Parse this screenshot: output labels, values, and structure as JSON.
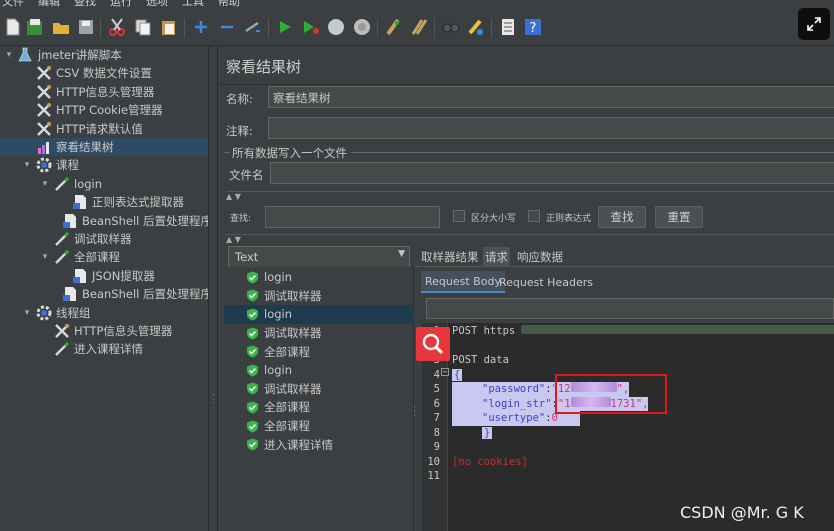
{
  "menubar": {
    "items": [
      "文件",
      "编辑",
      "查找",
      "运行",
      "选项",
      "工具",
      "帮助"
    ]
  },
  "toolbar": {
    "icons": [
      "new-icon",
      "templates-icon",
      "open-icon",
      "save-icon",
      "cut-icon",
      "copy-icon",
      "paste-icon",
      "expand-icon",
      "collapse-icon",
      "toggle-icon",
      "start-icon",
      "start-no-pause-icon",
      "stop-icon",
      "shutdown-icon",
      "clear-icon",
      "clear-all-icon",
      "search-icon",
      "reset-search-icon",
      "function-helper-icon",
      "help-icon"
    ]
  },
  "tree": {
    "items": [
      {
        "label": "jmeter讲解脚本",
        "icon": "flask-icon",
        "level": 0,
        "arrow": "▾"
      },
      {
        "label": "CSV 数据文件设置",
        "icon": "tools-icon",
        "level": 1
      },
      {
        "label": "HTTP信息头管理器",
        "icon": "tools-icon",
        "level": 1
      },
      {
        "label": "HTTP Cookie管理器",
        "icon": "tools-icon",
        "level": 1
      },
      {
        "label": "HTTP请求默认值",
        "icon": "tools-icon",
        "level": 1
      },
      {
        "label": "察看结果树",
        "icon": "chart-icon",
        "level": 1,
        "selected": true
      },
      {
        "label": "课程",
        "icon": "gear-icon",
        "level": 1,
        "arrow": "▾"
      },
      {
        "label": "login",
        "icon": "pipette-icon",
        "level": 2,
        "arrow": "▾"
      },
      {
        "label": "正则表达式提取器",
        "icon": "script-icon",
        "level": 3
      },
      {
        "label": "BeanShell 后置处理程序",
        "icon": "script-icon",
        "level": 3
      },
      {
        "label": "调试取样器",
        "icon": "pipette-icon",
        "level": 2
      },
      {
        "label": "全部课程",
        "icon": "pipette-icon",
        "level": 2,
        "arrow": "▾"
      },
      {
        "label": "JSON提取器",
        "icon": "script-icon",
        "level": 3
      },
      {
        "label": "BeanShell 后置处理程序",
        "icon": "script-icon",
        "level": 3
      },
      {
        "label": "线程组",
        "icon": "gear-icon",
        "level": 1,
        "arrow": "▾"
      },
      {
        "label": "HTTP信息头管理器",
        "icon": "tools-icon",
        "level": 2
      },
      {
        "label": "进入课程详情",
        "icon": "pipette-icon",
        "level": 2
      }
    ]
  },
  "panel": {
    "title": "察看结果树",
    "name_label": "名称:",
    "name_value": "察看结果树",
    "comment_label": "注释:",
    "comment_value": "",
    "write_all_label": "所有数据写入一个文件",
    "filename_label": "文件名",
    "search_label": "查找:",
    "case_label": "区分大小写",
    "regex_label": "正则表达式",
    "find_button": "查找",
    "reset_button": "重置"
  },
  "renderer": {
    "selected": "Text"
  },
  "samples": [
    {
      "label": "login"
    },
    {
      "label": "调试取样器"
    },
    {
      "label": "login",
      "selected": true
    },
    {
      "label": "调试取样器"
    },
    {
      "label": "全部课程"
    },
    {
      "label": "login"
    },
    {
      "label": "调试取样器"
    },
    {
      "label": "全部课程"
    },
    {
      "label": "全部课程"
    },
    {
      "label": "进入课程详情"
    }
  ],
  "tabs": [
    "取样器结果",
    "请求",
    "响应数据"
  ],
  "active_tab": "请求",
  "subtabs": [
    "Request Body",
    "Request Headers"
  ],
  "active_subtab": "Request Body",
  "editor": {
    "lines": [
      {
        "n": "1",
        "text": "POST https"
      },
      {
        "n": "2",
        "text": ""
      },
      {
        "n": "3",
        "text": "POST data"
      },
      {
        "n": "4",
        "text": "{"
      },
      {
        "n": "5",
        "key": "\"password\"",
        "val": "\"12"
      },
      {
        "n": "6",
        "key": "\"login_str\"",
        "val": "\"1",
        "tail": "1731\","
      },
      {
        "n": "7",
        "key": "\"usertype\"",
        "val": "0"
      },
      {
        "n": "8",
        "text": "}"
      },
      {
        "n": "9",
        "text": ""
      },
      {
        "n": "10",
        "text": "[no cookies]"
      },
      {
        "n": "11",
        "text": ""
      }
    ]
  },
  "watermark": "CSDN @Mr. G K",
  "colors": {
    "background": "#3c3f41",
    "selection": "#2f4b63",
    "highlight_box": "#e01818",
    "magnifier": "#e8363d"
  }
}
